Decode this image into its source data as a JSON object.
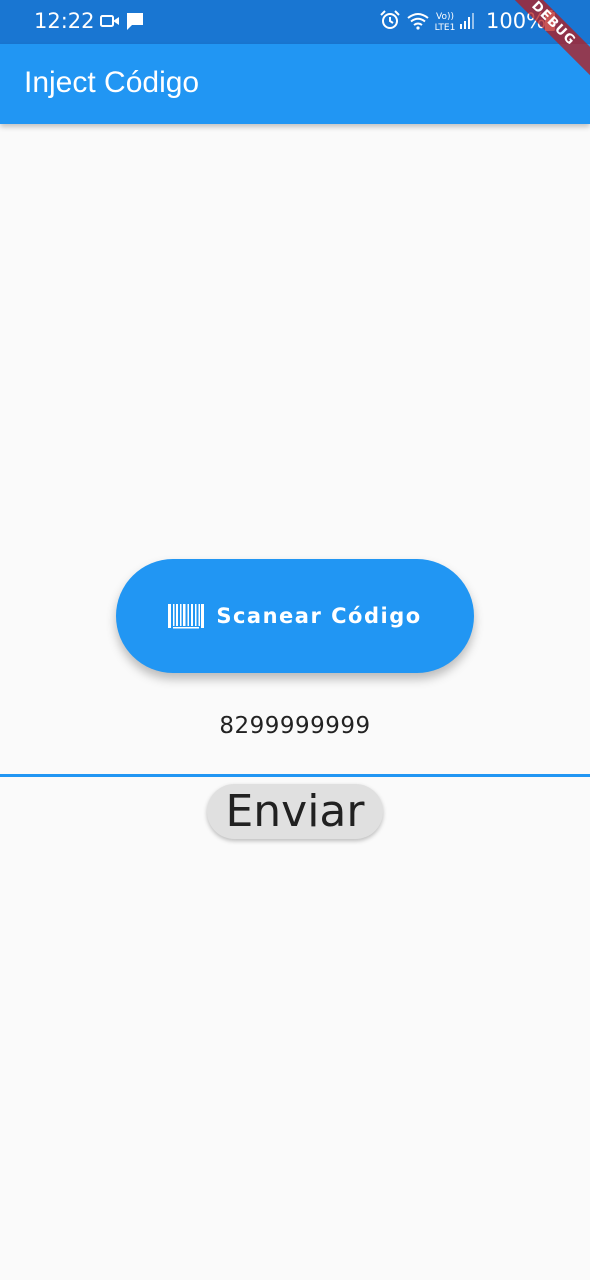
{
  "status_bar": {
    "time": "12:22",
    "battery_percent": "100%",
    "network_label_top": "Vo))",
    "network_label_bottom": "LTE1",
    "icons": [
      "video-icon",
      "message-icon",
      "alarm-icon",
      "wifi-icon",
      "signal-icon",
      "battery-icon"
    ]
  },
  "debug_banner": {
    "label": "DEBUG"
  },
  "app_bar": {
    "title": "Inject Código"
  },
  "scan_button": {
    "label": "Scanear Código",
    "icon": "barcode-icon"
  },
  "scanned_code": {
    "value": "8299999999"
  },
  "send_button": {
    "label": "Enviar"
  },
  "colors": {
    "status_bar": "#1976d2",
    "primary": "#2196f3",
    "background": "#fafafa",
    "send_button": "#e0e0e0"
  }
}
